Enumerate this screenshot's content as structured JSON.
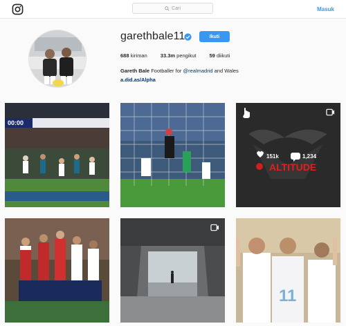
{
  "header": {
    "search_placeholder": "Cari",
    "login_label": "Masuk"
  },
  "profile": {
    "username": "garethbale11",
    "follow_label": "Ikuti",
    "stats": [
      {
        "value": "688",
        "label": "kiriman"
      },
      {
        "value": "33.3m",
        "label": "pengikut"
      },
      {
        "value": "59",
        "label": "diikuti"
      }
    ],
    "full_name": "Gareth Bale",
    "bio_text": "Footballer for",
    "bio_mention": "@realmadrid",
    "bio_tail": "and Wales",
    "website": "a.did.as/Alpha"
  },
  "posts": {
    "post1_banner": "00:00",
    "post3_likes": "151k",
    "post3_comments": "1,234",
    "post3_brand": "ALTITUDE",
    "post6_number": "11"
  }
}
